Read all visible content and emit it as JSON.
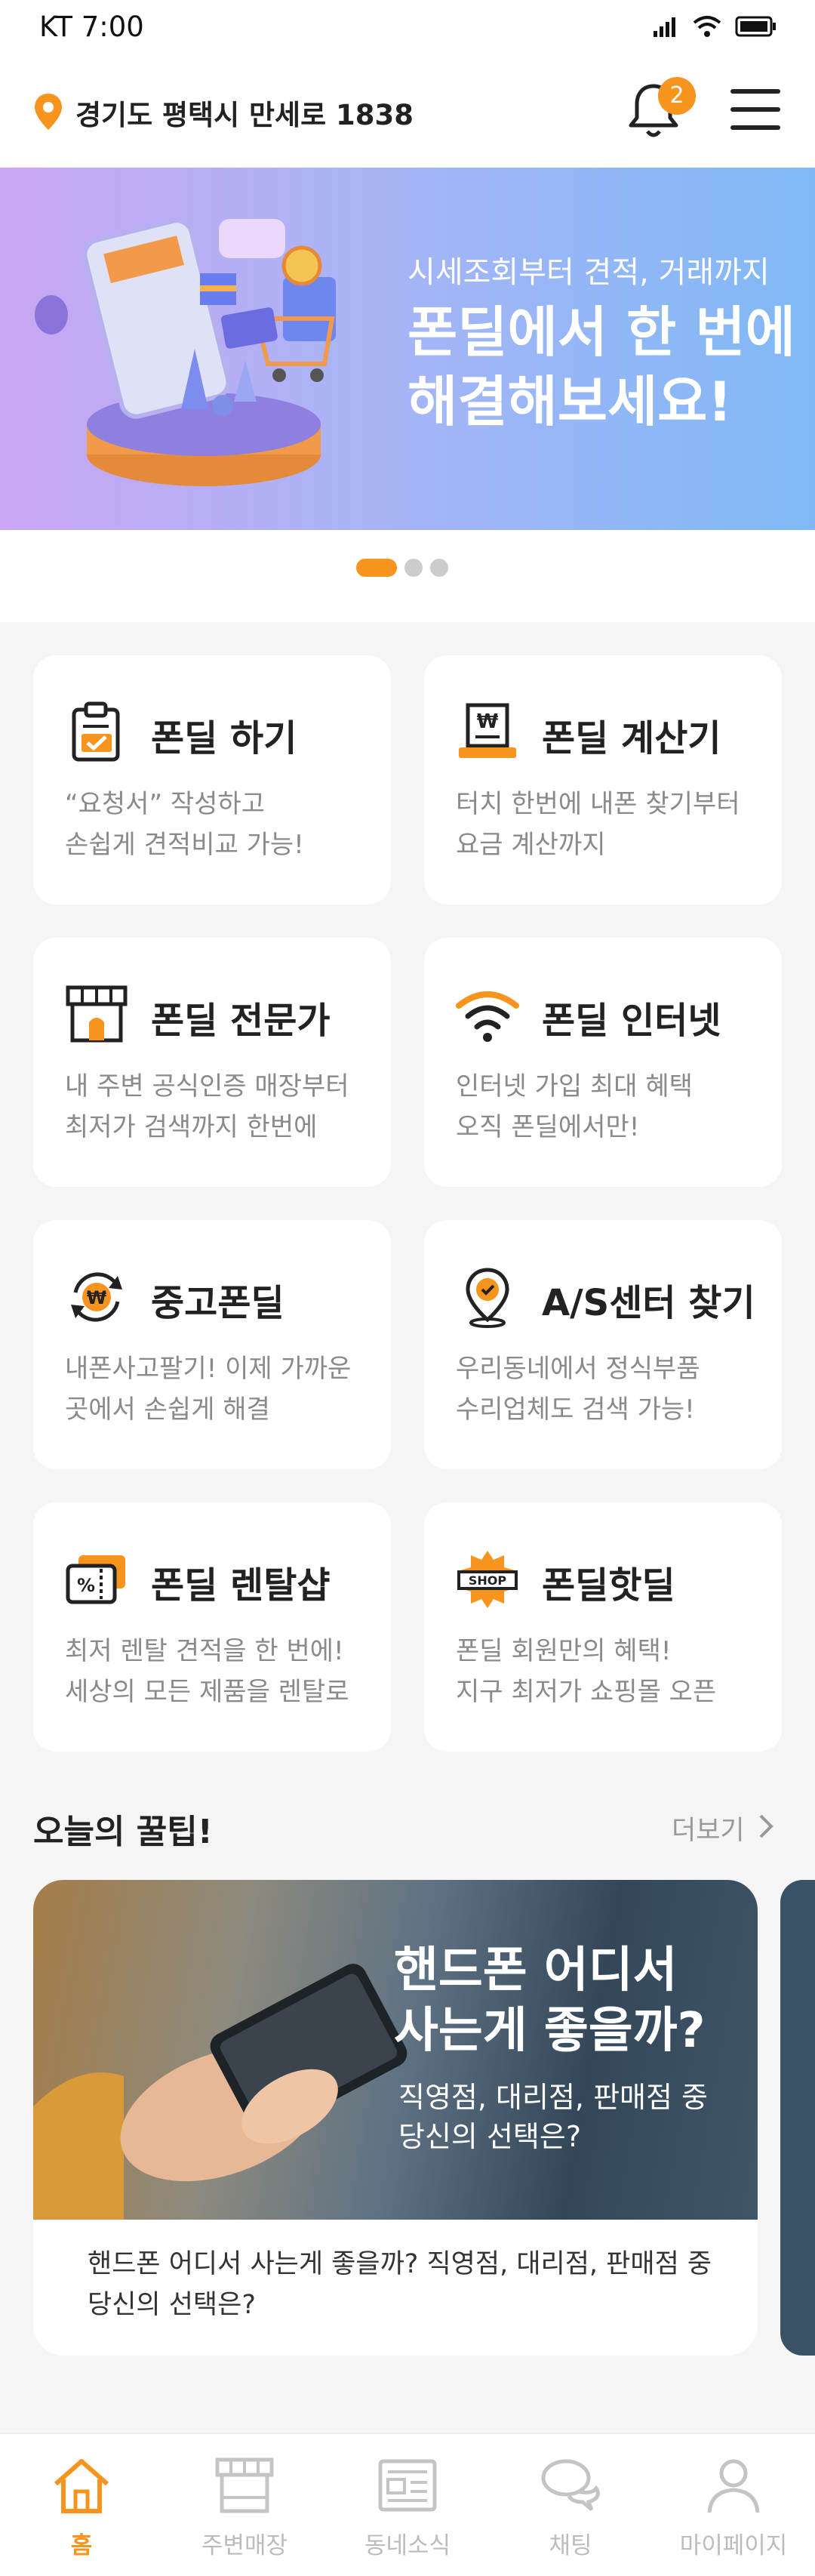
{
  "status_bar": {
    "carrier_time": "KT 7:00"
  },
  "header": {
    "location": "경기도 평택시 만세로 1838",
    "notification_count": "2"
  },
  "banner": {
    "subtitle": "시세조회부터 견적, 거래까지",
    "title_line1": "폰딜에서 한 번에",
    "title_line2": "해결해보세요!"
  },
  "carousel": {
    "page_count": 3,
    "active_index": 0
  },
  "services": [
    {
      "title": "폰딜 하기",
      "desc1": "“요청서” 작성하고",
      "desc2": "손쉽게 견적비교 가능!",
      "icon": "clipboard-icon"
    },
    {
      "title": "폰딜 계산기",
      "desc1": "터치 한번에 내폰 찾기부터",
      "desc2": "요금 계산까지",
      "icon": "receipt-icon"
    },
    {
      "title": "폰딜 전문가",
      "desc1": "내 주변 공식인증 매장부터",
      "desc2": "최저가 검색까지 한번에",
      "icon": "store-icon"
    },
    {
      "title": "폰딜 인터넷",
      "desc1": "인터넷 가입 최대 혜택",
      "desc2": "오직 폰딜에서만!",
      "icon": "wifi-icon"
    },
    {
      "title": "중고폰딜",
      "desc1": "내폰사고팔기! 이제 가까운",
      "desc2": "곳에서 손쉽게 해결",
      "icon": "won-exchange-icon"
    },
    {
      "title": "A/S센터 찾기",
      "desc1": "우리동네에서 정식부품",
      "desc2": "수리업체도 검색 가능!",
      "icon": "location-check-icon"
    },
    {
      "title": "폰딜 렌탈샵",
      "desc1": "최저 렌탈 견적을 한 번에!",
      "desc2": "세상의 모든 제품을 렌탈로",
      "icon": "coupon-icon"
    },
    {
      "title": "폰딜핫딜",
      "desc1": "폰딜 회원만의 혜택!",
      "desc2": "지구 최저가 쇼핑몰 오픈",
      "icon": "shop-badge-icon"
    }
  ],
  "shop_badge_text": "SHOP",
  "tips": {
    "section_title": "오늘의 꿀팁!",
    "more_label": "더보기",
    "card": {
      "image_title_line1": "핸드폰 어디서",
      "image_title_line2": "사는게 좋을까?",
      "image_sub_line1": "직영점, 대리점, 판매점 중",
      "image_sub_line2": "당신의 선택은?",
      "caption": "핸드폰 어디서 사는게 좋을까? 직영점, 대리점, 판매점 중 당신의 선택은?"
    }
  },
  "bottom_nav": [
    {
      "label": "홈",
      "icon": "home-icon",
      "active": true
    },
    {
      "label": "주변매장",
      "icon": "store-icon",
      "active": false
    },
    {
      "label": "동네소식",
      "icon": "newspaper-icon",
      "active": false
    },
    {
      "label": "채팅",
      "icon": "chat-icon",
      "active": false
    },
    {
      "label": "마이페이지",
      "icon": "user-icon",
      "active": false
    }
  ],
  "colors": {
    "accent": "#f7941d",
    "muted_text": "#8a8a8a",
    "nav_inactive": "#bcbcbc"
  }
}
